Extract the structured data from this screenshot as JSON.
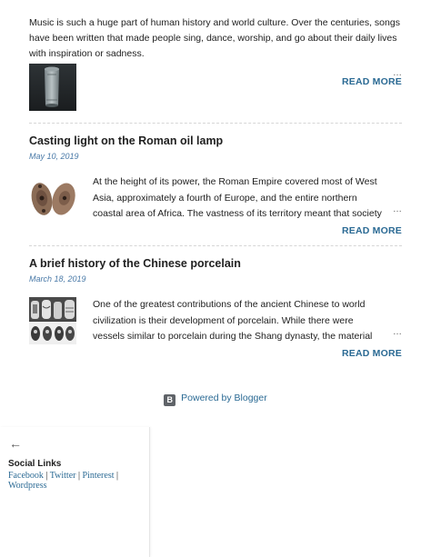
{
  "intro": {
    "snippet": "Music is such a huge part of human history and world culture. Over the centuries, songs have been written that made people sing, dance, worship, and go about their daily lives with inspiration or sadness.",
    "ellipsis": "…",
    "read_more": "READ MORE"
  },
  "posts": [
    {
      "title": "Casting light on the Roman oil lamp",
      "date": "May 10, 2019",
      "snippet": "At the height of its power, the Roman Empire covered most of West Asia, approximately a fourth of Europe, and the entire northern coastal area of Africa. The vastness of its territory meant that society today has been gifted with countless ancient a",
      "ellipsis": "…",
      "read_more": "READ MORE"
    },
    {
      "title": "A brief history of the Chinese porcelain",
      "date": "March 18, 2019",
      "snippet": "One of the greatest contributions of the ancient Chinese to world civilization is their development of porcelain. While there were vessels similar to porcelain during the Shang dynasty, the material only became widely used in the nation during",
      "ellipsis": "…",
      "read_more": "READ MORE"
    }
  ],
  "footer": {
    "powered_by": "Powered by Blogger",
    "blogger_glyph": "B"
  },
  "sidebar": {
    "back_arrow": "←",
    "title": "Social Links",
    "links": [
      "Facebook",
      "Twitter",
      "Pinterest",
      "Wordpress"
    ],
    "separator": "|"
  },
  "colors": {
    "link": "#2b6a94",
    "date": "#4a7aa8",
    "text": "#212121"
  }
}
